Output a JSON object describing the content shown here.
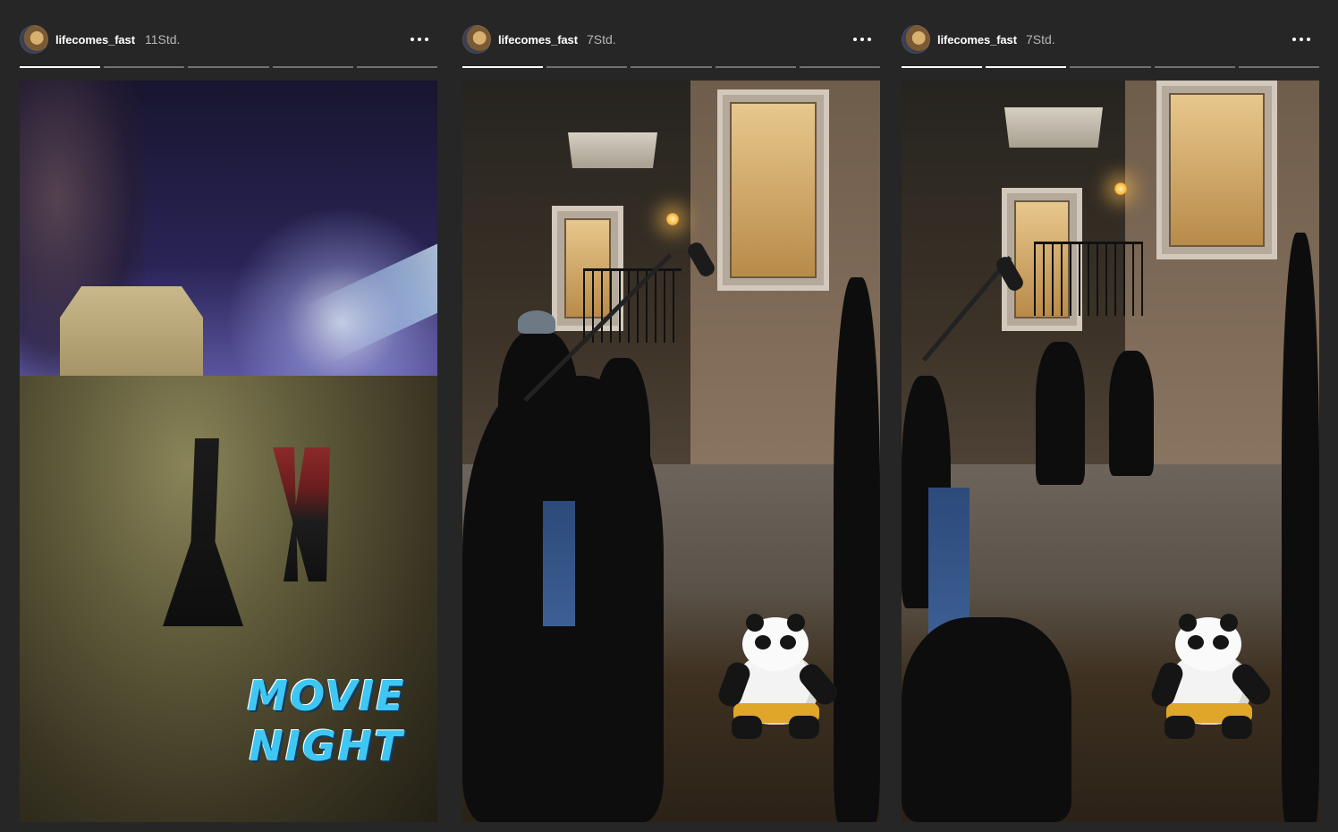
{
  "stories": [
    {
      "username": "lifecomes_fast",
      "time": "11Std.",
      "segments": [
        1,
        0,
        0,
        0,
        0
      ],
      "sticker_line1": "MOVIE",
      "sticker_line2": "NIGHT"
    },
    {
      "username": "lifecomes_fast",
      "time": "7Std.",
      "segments": [
        1,
        0,
        0,
        0,
        0
      ]
    },
    {
      "username": "lifecomes_fast",
      "time": "7Std.",
      "segments": [
        1,
        1,
        0,
        0,
        0
      ]
    }
  ],
  "colors": {
    "background": "#262626",
    "progress_active": "#ffffff",
    "progress_inactive": "rgba(255,255,255,0.35)",
    "sticker_blue": "#3ec7f2"
  },
  "icons": {
    "more": "more-horizontal-icon",
    "sticker": "panda-sticker-icon"
  }
}
